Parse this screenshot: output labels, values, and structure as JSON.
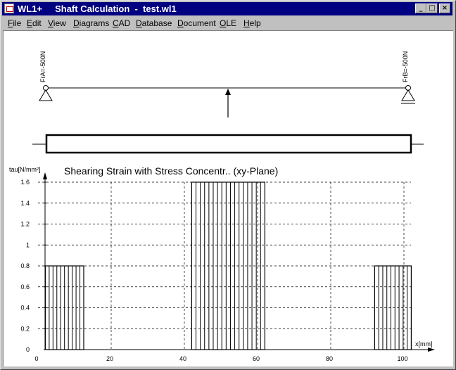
{
  "window": {
    "title": "WL1+     Shaft Calculation  -  test.wl1",
    "controls": {
      "minimize": "_",
      "maximize": "□",
      "close": "×"
    }
  },
  "menu": [
    "File",
    "Edit",
    "View",
    "Diagrams",
    "CAD",
    "Database",
    "Document",
    "OLE",
    "Help"
  ],
  "shaft": {
    "support_a_label": "FrA=-500N",
    "support_b_label": "FrB=-500N"
  },
  "chart_data": {
    "type": "bar",
    "title": "Shearing Strain with Stress Concentr.. (xy-Plane)",
    "xlabel": "x[mm]",
    "ylabel": "tau[N/mm²]",
    "xlim": [
      0,
      100
    ],
    "ylim": [
      0,
      1.6
    ],
    "x_ticks": [
      "0",
      "20",
      "40",
      "60",
      "80",
      "100"
    ],
    "y_ticks": [
      "0",
      "0.2",
      "0.4",
      "0.6",
      "0.8",
      "1",
      "1.2",
      "1.4",
      "1.6"
    ],
    "grid": true,
    "segments": [
      {
        "x_start": 2,
        "x_end": 12.5,
        "value": 0.8,
        "bars": 10
      },
      {
        "x_start": 42,
        "x_end": 62,
        "value": 1.6,
        "bars": 17
      },
      {
        "x_start": 92,
        "x_end": 102,
        "value": 0.8,
        "bars": 9
      }
    ]
  }
}
